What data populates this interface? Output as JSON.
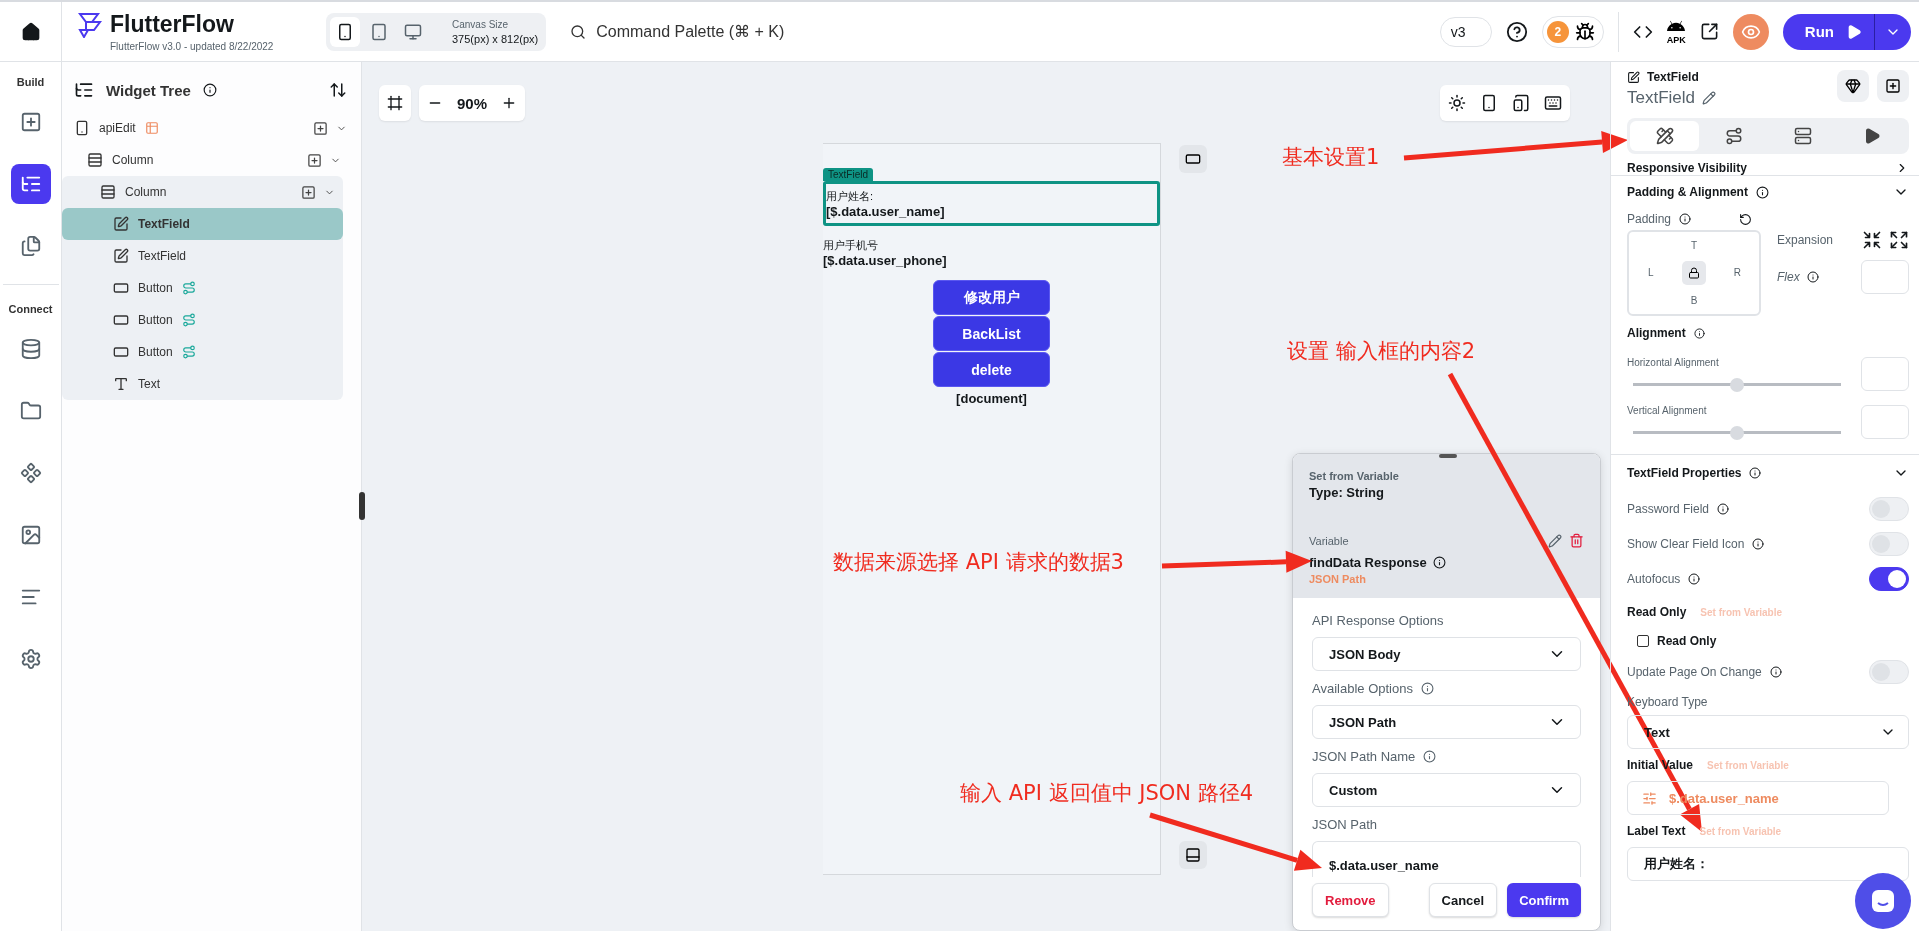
{
  "topbar": {
    "brand": "FlutterFlow",
    "version_note": "FlutterFlow v3.0 - updated 8/22/2022",
    "devices": [
      {
        "kind": "phone",
        "selected": true
      },
      {
        "kind": "tablet",
        "selected": false
      },
      {
        "kind": "desktop",
        "selected": false
      }
    ],
    "canvas_size_label": "Canvas Size",
    "canvas_size": "375(px) x 812(px)",
    "command_palette": "Command Palette (⌘ + K)",
    "version": "v3",
    "issue_count": "2",
    "apk_label": "APK",
    "run_label": "Run"
  },
  "rail": {
    "sections": [
      {
        "label": "Build",
        "items": [
          {
            "kind": "add-widget",
            "selected": false
          },
          {
            "kind": "widget-tree",
            "selected": true
          },
          {
            "kind": "pages",
            "selected": false
          }
        ]
      },
      {
        "label": "Connect",
        "items": [
          {
            "kind": "database",
            "selected": false
          },
          {
            "kind": "media",
            "selected": false
          },
          {
            "kind": "components",
            "selected": false
          },
          {
            "kind": "images",
            "selected": false
          },
          {
            "kind": "outline",
            "selected": false
          },
          {
            "kind": "settings",
            "selected": false
          }
        ]
      }
    ]
  },
  "widget_tree": {
    "title": "Widget Tree",
    "nodes": [
      {
        "kind": "page",
        "label": "apiEdit",
        "selected": false,
        "children": [
          {
            "kind": "column",
            "label": "Column",
            "selected": false,
            "children": [
              {
                "kind": "column",
                "label": "Column",
                "selected": false,
                "children": [
                  {
                    "kind": "textfield",
                    "label": "TextField",
                    "selected": true,
                    "actions": false
                  },
                  {
                    "kind": "textfield",
                    "label": "TextField",
                    "selected": false,
                    "actions": false
                  },
                  {
                    "kind": "button",
                    "label": "Button",
                    "selected": false,
                    "actions": true
                  },
                  {
                    "kind": "button",
                    "label": "Button",
                    "selected": false,
                    "actions": true
                  },
                  {
                    "kind": "button",
                    "label": "Button",
                    "selected": false,
                    "actions": true
                  },
                  {
                    "kind": "text",
                    "label": "Text",
                    "selected": false,
                    "actions": false
                  }
                ]
              }
            ]
          }
        ]
      }
    ]
  },
  "canvas": {
    "zoom": "90%",
    "tag": "TextField",
    "fields": [
      {
        "label": "用户姓名:",
        "value": "[$.data.user_name]",
        "selected": true
      },
      {
        "label": "用户手机号",
        "value": "[$.data.user_phone]",
        "selected": false
      }
    ],
    "buttons": [
      "修改用户",
      "BackList",
      "delete"
    ],
    "text": "[document]"
  },
  "popup": {
    "title": "Set from Variable",
    "type": "Type: String",
    "variable_label": "Variable",
    "variable": "findData Response",
    "variable_sub": "JSON Path",
    "fields": [
      {
        "kind": "dropdown",
        "label": "API Response Options",
        "value": "JSON Body",
        "info": false
      },
      {
        "kind": "dropdown",
        "label": "Available Options",
        "value": "JSON Path",
        "info": true
      },
      {
        "kind": "dropdown",
        "label": "JSON Path Name",
        "value": "Custom",
        "info": true
      },
      {
        "kind": "input",
        "label": "JSON Path",
        "value": "$.data.user_name",
        "info": false
      }
    ],
    "remove": "Remove",
    "cancel": "Cancel",
    "confirm": "Confirm"
  },
  "properties": {
    "widget_kind": "TextField",
    "widget_name": "TextField",
    "tabs": [
      {
        "kind": "design",
        "selected": true
      },
      {
        "kind": "actions",
        "selected": false
      },
      {
        "kind": "backend",
        "selected": false
      },
      {
        "kind": "preview",
        "selected": false
      }
    ],
    "collapsed_section": "Responsive Visibility",
    "padding_title": "Padding & Alignment",
    "padding_label": "Padding",
    "sides": [
      "T",
      "L",
      "R",
      "B"
    ],
    "expansion_label": "Expansion",
    "flex_label": "Flex",
    "alignment_label": "Alignment",
    "sliders": [
      {
        "label": "Horizontal Alignment",
        "level": 0.5
      },
      {
        "label": "Vertical Alignment",
        "level": 0.5
      }
    ],
    "textfield_title": "TextField Properties",
    "rows": [
      {
        "kind": "toggle",
        "label": "Password Field",
        "on": false
      },
      {
        "kind": "toggle",
        "label": "Show Clear Field Icon",
        "on": false
      },
      {
        "kind": "toggle",
        "label": "Autofocus",
        "on": true
      },
      {
        "kind": "heading",
        "label": "Read Only",
        "link": "Set from Variable"
      },
      {
        "kind": "checkbox",
        "label": "Read Only",
        "checked": false
      },
      {
        "kind": "toggle",
        "label": "Update Page On Change",
        "on": false
      },
      {
        "kind": "dropdown",
        "label": "Keyboard Type",
        "value": "Text"
      },
      {
        "kind": "variable",
        "label": "Initial Value",
        "link": "Set from Variable",
        "value": "$.data.user_name",
        "bound": true
      },
      {
        "kind": "variable",
        "label": "Label Text",
        "link": "Set from Variable",
        "value": "用户姓名：",
        "bound": false
      }
    ]
  },
  "annotations": [
    {
      "text": "基本设置1"
    },
    {
      "text": "设置 输入框的内容2"
    },
    {
      "text": "数据来源选择 API 请求的数据3"
    },
    {
      "text": "输入 API 返回值中 JSON 路径4"
    }
  ]
}
